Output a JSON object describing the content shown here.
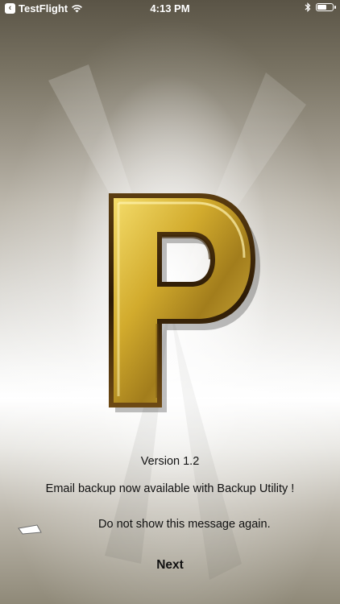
{
  "status_bar": {
    "back_app": "TestFlight",
    "time": "4:13 PM"
  },
  "logo": {
    "letter": "P",
    "colors": {
      "gold_light": "#f1d45a",
      "gold": "#c9a227",
      "gold_dark": "#7a5a14",
      "outline": "#2a1c0a"
    }
  },
  "content": {
    "version": "Version 1.2",
    "message": "Email backup now available with Backup Utility !",
    "checkbox_label": "Do not show this message again.",
    "checkbox_checked": false
  },
  "actions": {
    "next_label": "Next"
  }
}
